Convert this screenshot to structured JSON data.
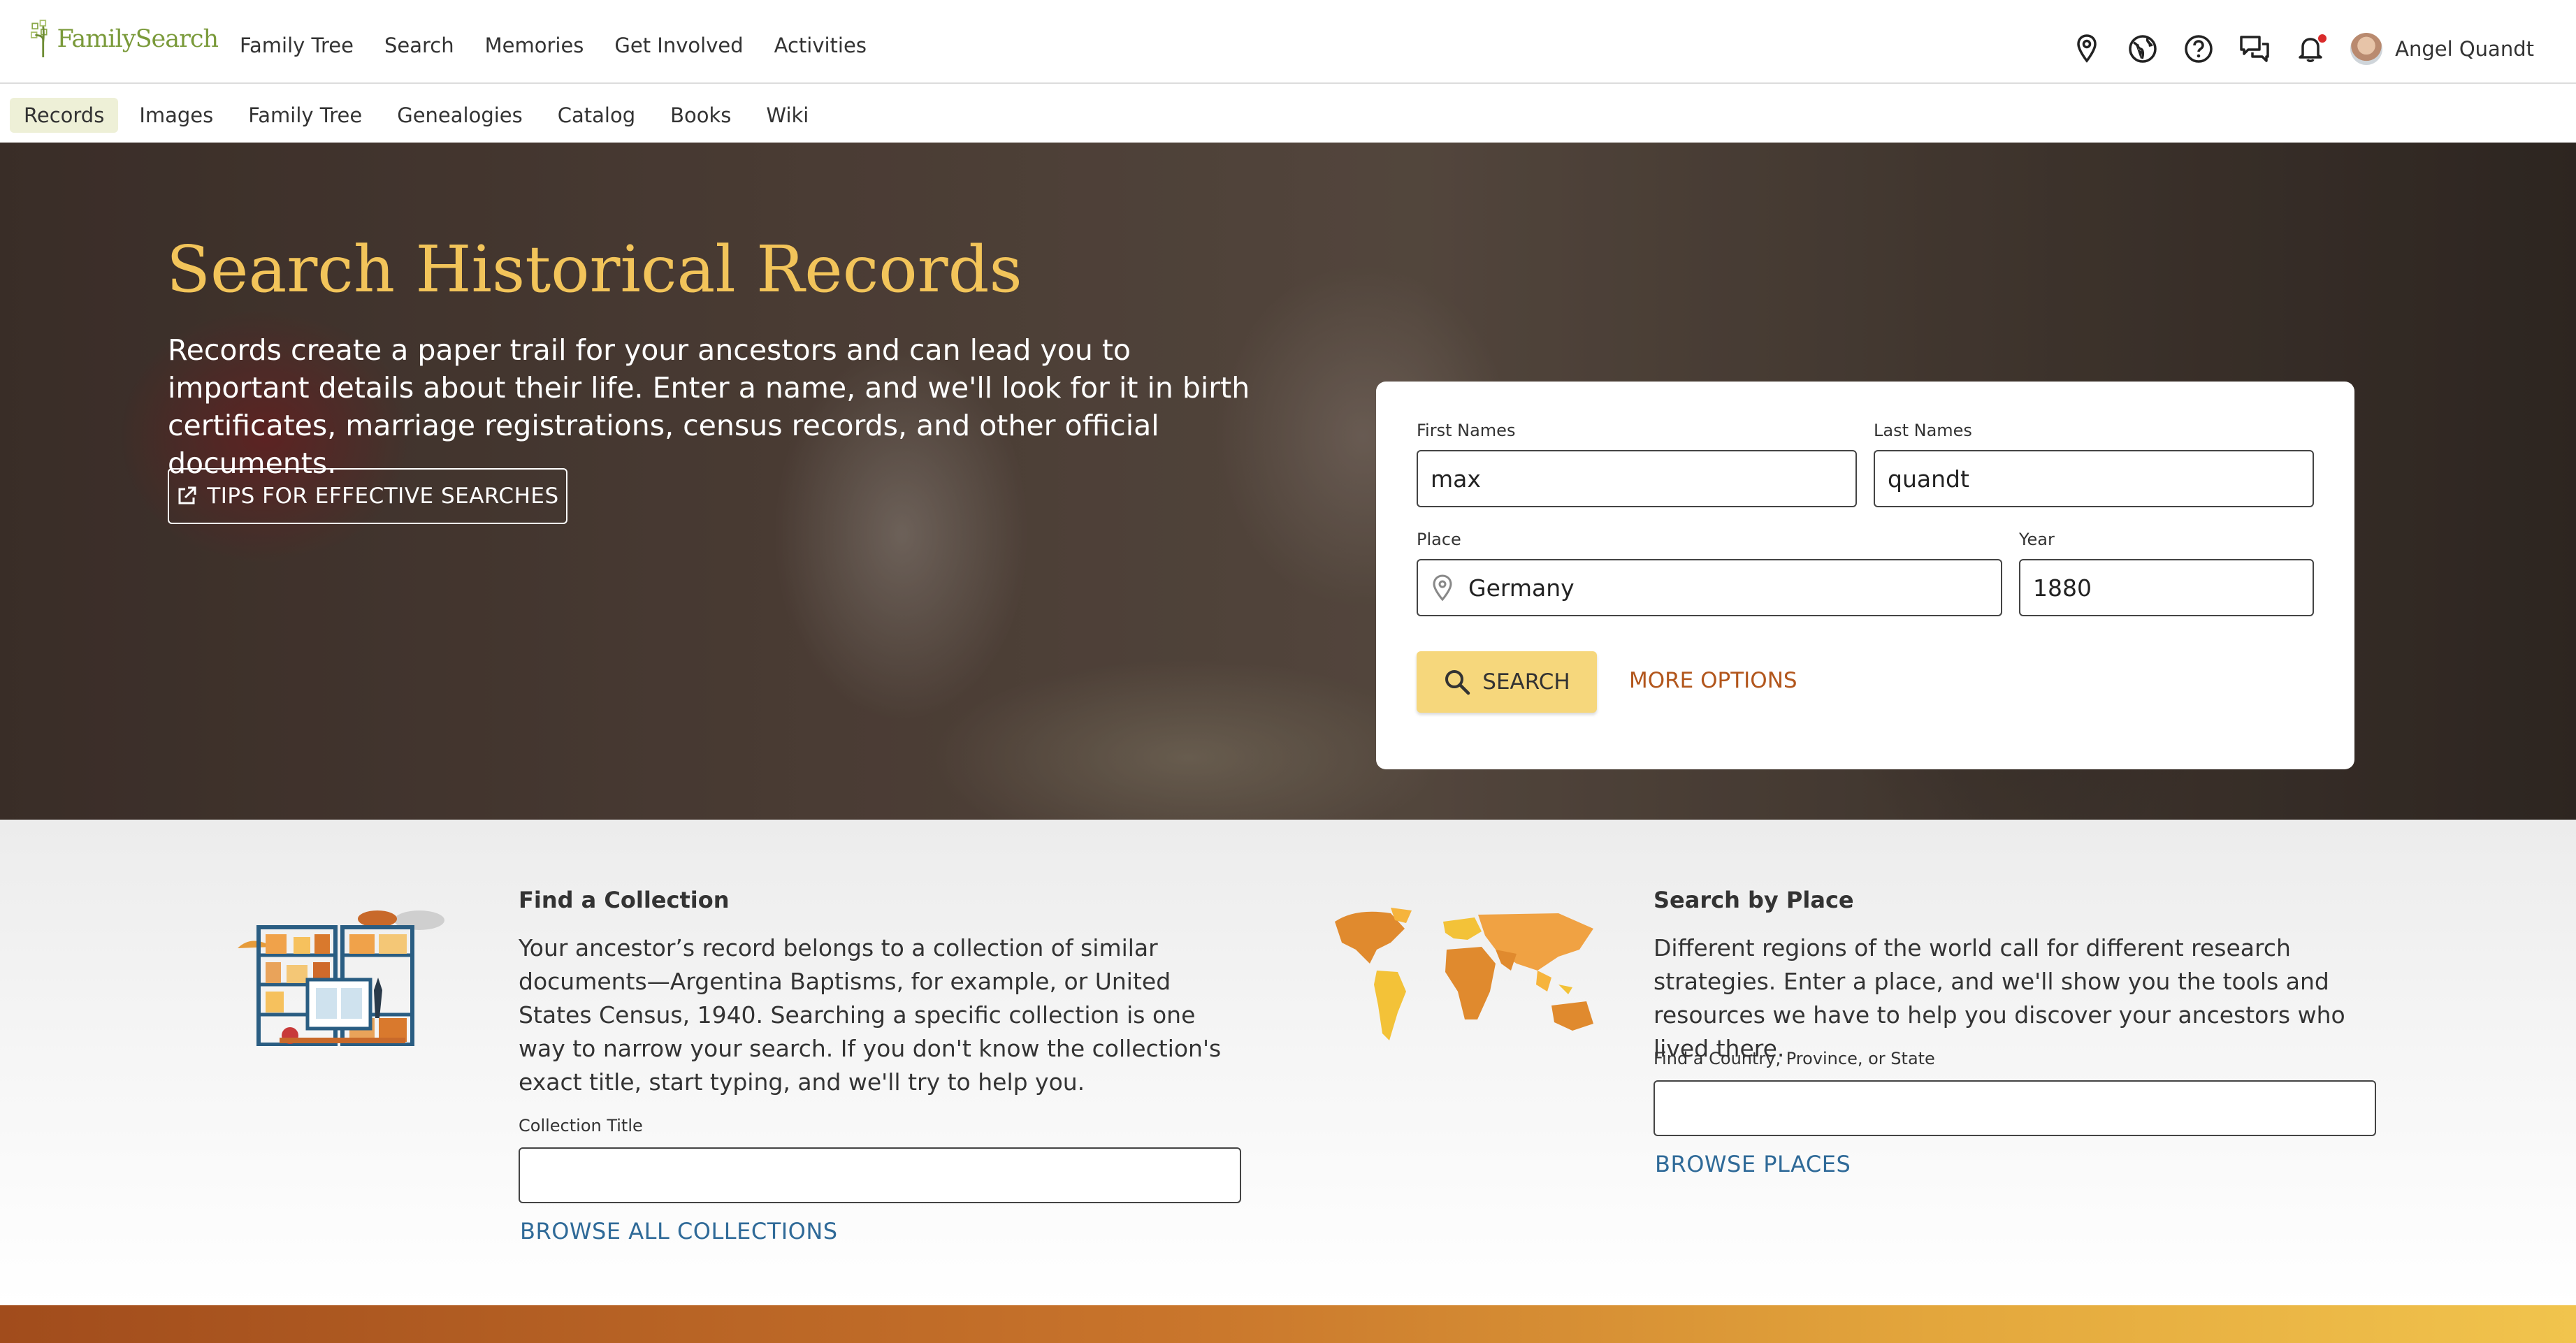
{
  "header": {
    "logo_text": "FamilySearch",
    "nav": [
      "Family Tree",
      "Search",
      "Memories",
      "Get Involved",
      "Activities"
    ],
    "icons": [
      "location-pin-icon",
      "globe-icon",
      "help-icon",
      "chat-icon",
      "bell-icon"
    ],
    "user_name": "Angel Quandt"
  },
  "subnav": {
    "items": [
      "Records",
      "Images",
      "Family Tree",
      "Genealogies",
      "Catalog",
      "Books",
      "Wiki"
    ],
    "active": "Records"
  },
  "hero": {
    "title": "Search Historical Records",
    "description": "Records create a paper trail for your ancestors and can lead you to important details about their life. Enter a name, and we'll look for it in birth certificates, marriage registrations, census records, and other official documents.",
    "tips_button": "TIPS FOR EFFECTIVE SEARCHES"
  },
  "search_form": {
    "first_names_label": "First Names",
    "first_names_value": "max",
    "last_names_label": "Last Names",
    "last_names_value": "quandt",
    "place_label": "Place",
    "place_value": "Germany",
    "year_label": "Year",
    "year_value": "1880",
    "search_button": "SEARCH",
    "more_options": "MORE OPTIONS"
  },
  "find_collection": {
    "title": "Find a Collection",
    "description": "Your ancestor’s record belongs to a collection of similar documents—Argentina Baptisms, for example, or United States Census, 1940. Searching a specific collection is one way to narrow your search. If you don't know the collection's exact title, start typing, and we'll try to help you.",
    "field_label": "Collection Title",
    "field_value": "",
    "browse_link": "BROWSE ALL COLLECTIONS"
  },
  "search_by_place": {
    "title": "Search by Place",
    "description": "Different regions of the world call for different research strategies. Enter a place, and we'll show you the tools and resources we have to help you discover your ancestors who lived there.",
    "field_label": "Find a Country, Province, or State",
    "field_value": "",
    "browse_link": "BROWSE PLACES"
  },
  "colors": {
    "accent_gold": "#f2c45a",
    "search_button": "#f6d77c",
    "link_blue": "#2f6a98",
    "more_options_orange": "#b2561c",
    "subnav_active_bg": "#eef0d7"
  }
}
